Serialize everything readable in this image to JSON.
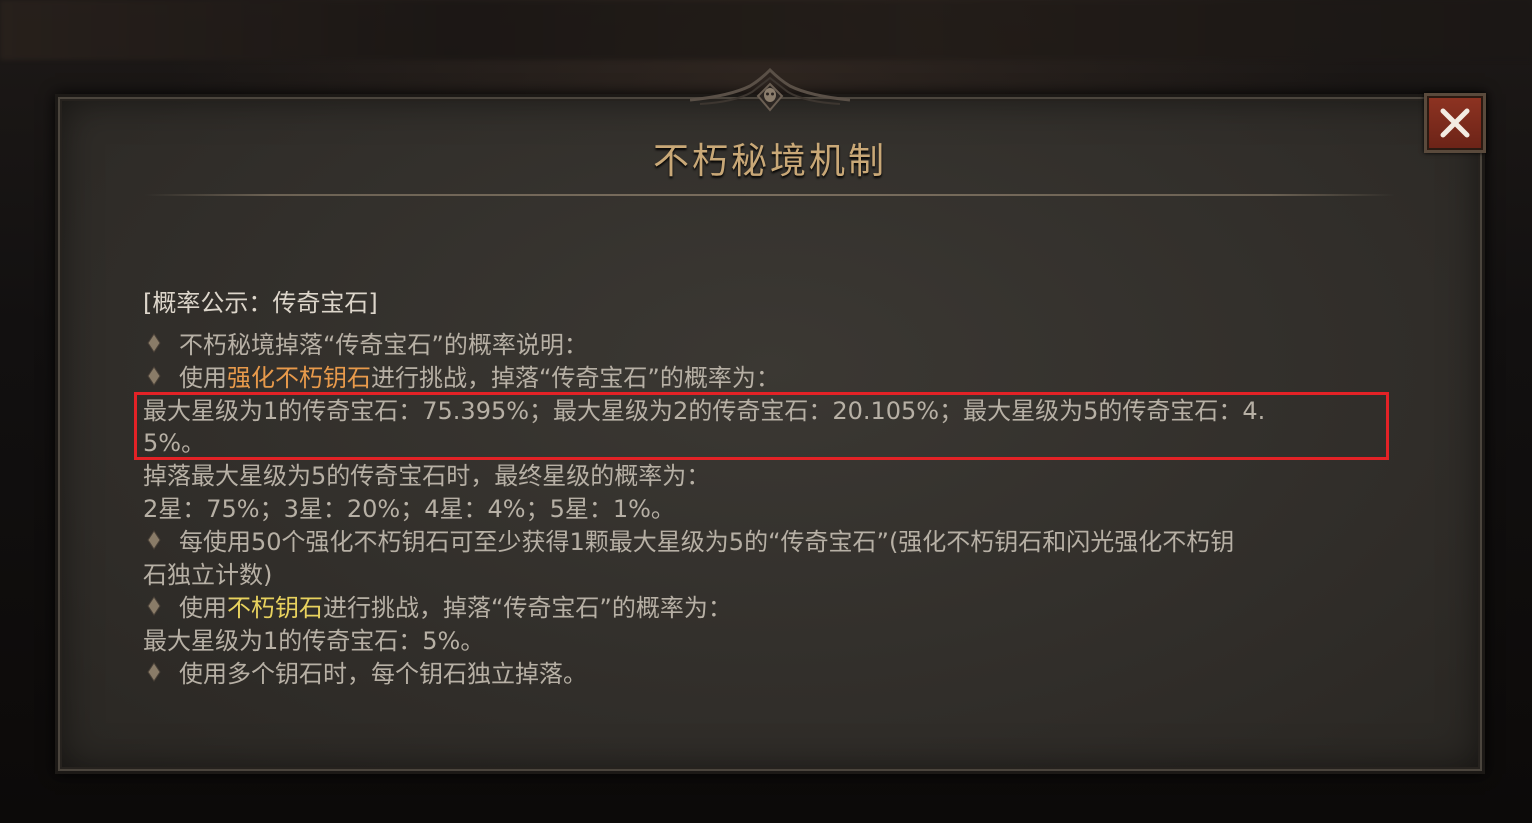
{
  "dialog": {
    "title": "不朽秘境机制",
    "close_label": "✕"
  },
  "content": {
    "header": "[概率公示：传奇宝石]",
    "item1": "不朽秘境掉落“传奇宝石”的概率说明：",
    "item2_prefix": "使用",
    "item2_key": "强化不朽钥石",
    "item2_suffix": "进行挑战，掉落“传奇宝石”的概率为：",
    "rates_line1": "最大星级为1的传奇宝石：75.395%；最大星级为2的传奇宝石：20.105%；最大星级为5的传奇宝石：4.",
    "rates_line2": "5%。",
    "star_intro": "掉落最大星级为5的传奇宝石时，最终星级的概率为：",
    "star_rates": "2星：75%；3星：20%；4星：4%；5星：1%。",
    "item3_line1": "每使用50个强化不朽钥石可至少获得1颗最大星级为5的“传奇宝石”(强化不朽钥石和闪光强化不朽钥",
    "item3_line2": "石独立计数)",
    "item4_prefix": "使用",
    "item4_key": "不朽钥石",
    "item4_suffix": "进行挑战，掉落“传奇宝石”的概率为：",
    "basic_rate": "最大星级为1的传奇宝石：5%。",
    "item5": "使用多个钥石时，每个钥石独立掉落。"
  },
  "colors": {
    "title": "#c9a877",
    "body_text": "#b7b0a5",
    "key_orange": "#e89a4b",
    "key_yellow": "#e8d25e",
    "highlight_border": "#e32226",
    "close_button": "#8e3322"
  }
}
